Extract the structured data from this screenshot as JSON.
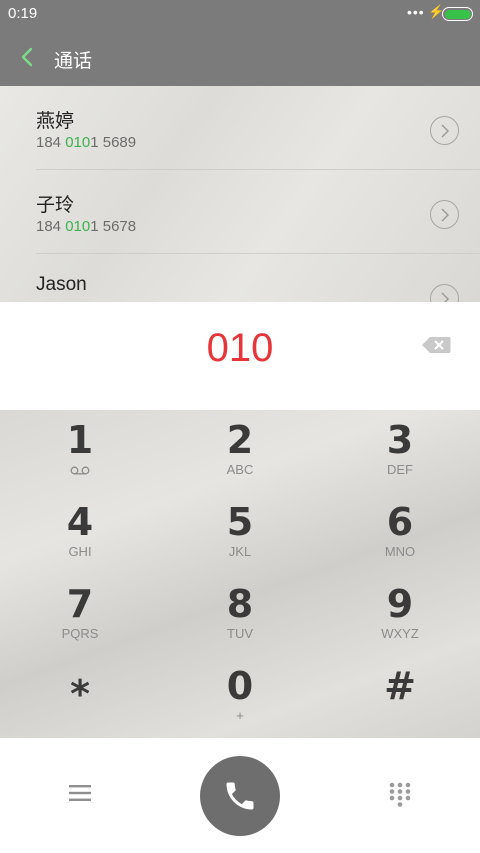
{
  "status_bar": {
    "time": "0:19",
    "dots": "•••",
    "bolt": "⚡"
  },
  "header": {
    "title": "通话"
  },
  "contacts": [
    {
      "name": "燕婷",
      "number_pre": "184 ",
      "number_match": "010",
      "number_post": "1 5689"
    },
    {
      "name": "子玲",
      "number_pre": "184 ",
      "number_match": "010",
      "number_post": "1 5678"
    },
    {
      "name": "Jason",
      "number_pre": "",
      "number_match": "",
      "number_post": ""
    }
  ],
  "dial_input": {
    "digits": "010"
  },
  "keypad": [
    {
      "digit": "1",
      "letters": ""
    },
    {
      "digit": "2",
      "letters": "ABC"
    },
    {
      "digit": "3",
      "letters": "DEF"
    },
    {
      "digit": "4",
      "letters": "GHI"
    },
    {
      "digit": "5",
      "letters": "JKL"
    },
    {
      "digit": "6",
      "letters": "MNO"
    },
    {
      "digit": "7",
      "letters": "PQRS"
    },
    {
      "digit": "8",
      "letters": "TUV"
    },
    {
      "digit": "9",
      "letters": "WXYZ"
    },
    {
      "digit": "*",
      "letters": ""
    },
    {
      "digit": "0",
      "letters": "+"
    },
    {
      "digit": "#",
      "letters": ""
    }
  ],
  "colors": {
    "header_bg": "#7b7b7b",
    "accent_red": "#e8353a",
    "accent_green": "#3cb24c",
    "call_button": "#6e6e6e"
  },
  "icons": [
    "back-arrow-icon",
    "battery-icon",
    "voicemail-icon",
    "chevron-right-icon",
    "backspace-icon",
    "menu-icon",
    "phone-icon",
    "dialpad-icon"
  ]
}
